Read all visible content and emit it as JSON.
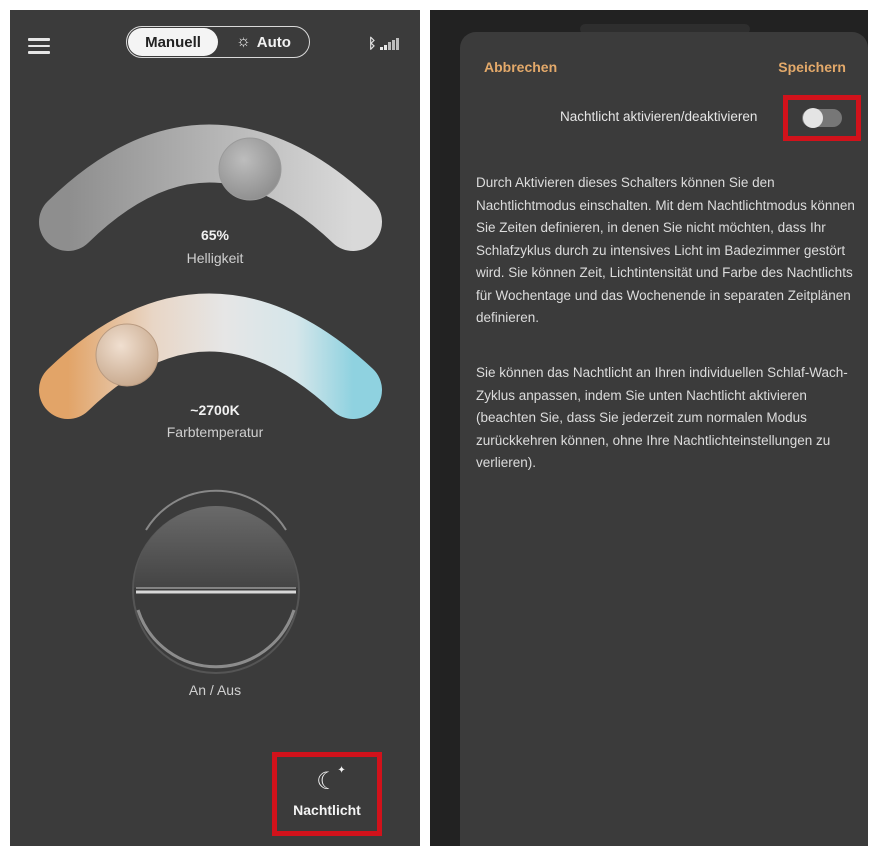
{
  "left": {
    "mode_toggle": {
      "manual_label": "Manuell",
      "auto_label": "Auto"
    },
    "brightness": {
      "value": "65%",
      "label": "Helligkeit",
      "level": 0.65
    },
    "color_temp": {
      "value": "~2700K",
      "label": "Farbtemperatur",
      "warm_color": "#e2a468",
      "cool_color": "#8fd2e0"
    },
    "power": {
      "label": "An / Aus"
    },
    "nightlight_button": {
      "label": "Nachtlicht"
    }
  },
  "right": {
    "cancel_label": "Abbrechen",
    "save_label": "Speichern",
    "toggle_label": "Nachtlicht aktivieren/deaktivieren",
    "toggle_on": false,
    "paragraph1": "Durch Aktivieren dieses Schalters können Sie den Nachtlichtmodus einschalten. Mit dem Nachtlichtmodus können Sie Zeiten definieren, in denen Sie nicht möchten, dass Ihr Schlafzyklus durch zu intensives Licht im Badezimmer gestört wird. Sie können Zeit, Lichtintensität und Farbe des Nachtlichts für Wochentage und das Wochenende in separaten Zeitplänen definieren.",
    "paragraph2": "Sie können das Nachtlicht an Ihren individuellen Schlaf-Wach-Zyklus anpassen, indem Sie unten Nachtlicht aktivieren (beachten Sie, dass Sie jederzeit zum normalen Modus zurückkehren können, ohne Ihre Nachtlichteinstellungen zu verlieren)."
  },
  "colors": {
    "accent": "#e3a96a",
    "highlight_box": "#d1121b",
    "background": "#3b3b3b"
  }
}
